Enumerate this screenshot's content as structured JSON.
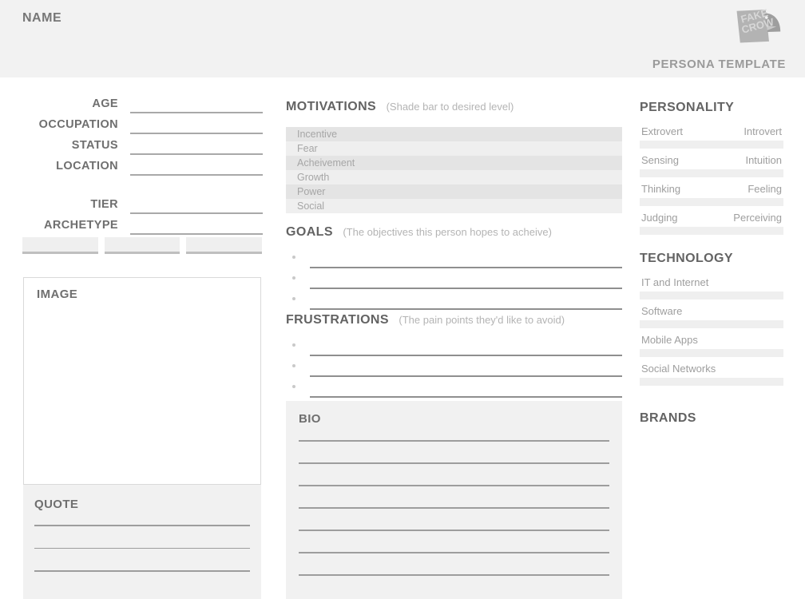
{
  "header": {
    "name_label": "NAME",
    "subtitle": "PERSONA TEMPLATE",
    "logo_line1": "FAKE",
    "logo_line2": "CROW",
    "logo_name": "fake-crow-logo"
  },
  "left": {
    "fields_primary": [
      {
        "label": "AGE"
      },
      {
        "label": "OCCUPATION"
      },
      {
        "label": "STATUS"
      },
      {
        "label": "LOCATION"
      }
    ],
    "fields_secondary": [
      {
        "label": "TIER"
      },
      {
        "label": "ARCHETYPE"
      }
    ],
    "tags": [
      {
        "label": ""
      },
      {
        "label": ""
      },
      {
        "label": ""
      }
    ],
    "image": {
      "label": "IMAGE"
    },
    "quote": {
      "label": "QUOTE",
      "lines": [
        "",
        "",
        ""
      ]
    }
  },
  "middle": {
    "motivations": {
      "title": "MOTIVATIONS",
      "hint": "(Shade bar to desired level)",
      "items": [
        {
          "label": "Incentive",
          "level": 0
        },
        {
          "label": "Fear",
          "level": 0
        },
        {
          "label": "Acheivement",
          "level": 0
        },
        {
          "label": "Growth",
          "level": 0
        },
        {
          "label": "Power",
          "level": 0
        },
        {
          "label": "Social",
          "level": 0
        }
      ]
    },
    "goals": {
      "title": "GOALS",
      "hint": "(The objectives this person hopes to acheive)",
      "lines": [
        "",
        "",
        ""
      ]
    },
    "frustrations": {
      "title": "FRUSTRATIONS",
      "hint": "(The pain points they'd like to avoid)",
      "lines": [
        "",
        "",
        ""
      ]
    },
    "bio": {
      "label": "BIO",
      "lines": [
        "",
        "",
        "",
        "",
        "",
        "",
        ""
      ]
    }
  },
  "right": {
    "personality": {
      "title": "PERSONALITY",
      "pairs": [
        {
          "left": "Extrovert",
          "right": "Introvert"
        },
        {
          "left": "Sensing",
          "right": "Intuition"
        },
        {
          "left": "Thinking",
          "right": "Feeling"
        },
        {
          "left": "Judging",
          "right": "Perceiving"
        }
      ]
    },
    "technology": {
      "title": "TECHNOLOGY",
      "items": [
        {
          "label": "IT and Internet"
        },
        {
          "label": "Software"
        },
        {
          "label": "Mobile Apps"
        },
        {
          "label": "Social Networks"
        }
      ]
    },
    "brands": {
      "title": "BRANDS"
    }
  },
  "colors": {
    "header_bg": "#f2f2f2",
    "panel_bg": "#f1f1f1",
    "bar_dark": "#e4e4e4",
    "bar_light": "#efefef",
    "heading_text": "#636363",
    "muted_text": "#a6a6a6",
    "rule": "#9d9d9d"
  }
}
